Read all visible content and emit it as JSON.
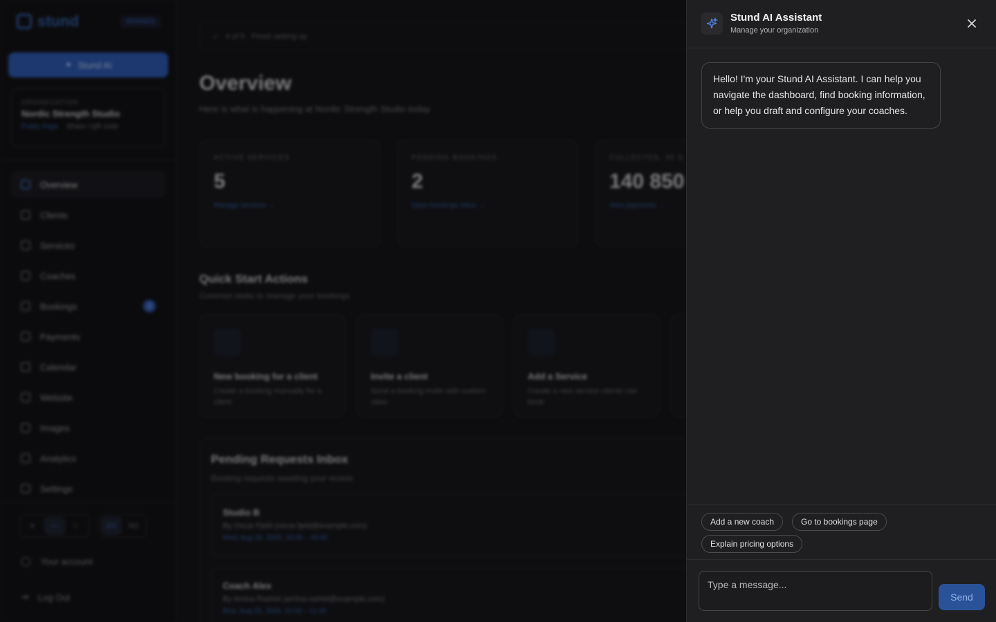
{
  "sidebar": {
    "brand": "stund",
    "badge": "BRANDS",
    "ai_button": "Stund AI",
    "org": {
      "kicker": "ORGANIZATION",
      "name": "Nordic Strength Studio",
      "public_page": "Public Page",
      "share": "Share / QR code"
    },
    "nav": [
      {
        "label": "Overview"
      },
      {
        "label": "Clients"
      },
      {
        "label": "Services"
      },
      {
        "label": "Coaches"
      },
      {
        "label": "Bookings",
        "badge": "2"
      },
      {
        "label": "Payments"
      },
      {
        "label": "Calendar"
      },
      {
        "label": "Website"
      },
      {
        "label": "Images"
      },
      {
        "label": "Analytics"
      },
      {
        "label": "Settings"
      }
    ],
    "lang": [
      "EN",
      "NO"
    ],
    "account": "Your account",
    "logout": "Log Out"
  },
  "main": {
    "setup": "4 of 5 · Finish setting up",
    "title": "Overview",
    "subtitle": "Here is what is happening at Nordic Strength Studio today",
    "stats": [
      {
        "kicker": "ACTIVE SERVICES",
        "value": "5",
        "link": "Manage services →"
      },
      {
        "kicker": "PENDING BOOKINGS",
        "value": "2",
        "link": "Open bookings inbox →"
      },
      {
        "kicker": "COLLECTED, 30 D",
        "value": "140 850",
        "link": "View payments →"
      }
    ],
    "quick_title": "Quick Start Actions",
    "quick_sub": "Common tasks to manage your bookings",
    "quick": [
      {
        "title": "New booking for a client",
        "desc": "Create a booking manually for a client"
      },
      {
        "title": "Invite a client",
        "desc": "Send a booking invite with custom rates"
      },
      {
        "title": "Add a Service",
        "desc": "Create a new service clients can book"
      }
    ],
    "inbox_title": "Pending Requests Inbox",
    "inbox_sub": "Booking requests awaiting your review",
    "requests": [
      {
        "title": "Studio B",
        "by": "By Oscar Fjeld (oscar.fjeld@example.com)",
        "when": "Wed, Aug 28, 2025, 18:00 – 20:00"
      },
      {
        "title": "Coach Alex",
        "by": "By Amina Rashid (amina.rashid@example.com)",
        "when": "Mon, Aug 26, 2025, 10:00 – 11:30"
      }
    ]
  },
  "assistant": {
    "title": "Stund AI Assistant",
    "subtitle": "Manage your organization",
    "message": "Hello! I'm your Stund AI Assistant. I can help you navigate the dashboard, find booking information, or help you draft and configure your coaches.",
    "suggestions": [
      "Add a new coach",
      "Go to bookings page",
      "Explain pricing options"
    ],
    "input_placeholder": "Type a message...",
    "send_label": "Send"
  }
}
